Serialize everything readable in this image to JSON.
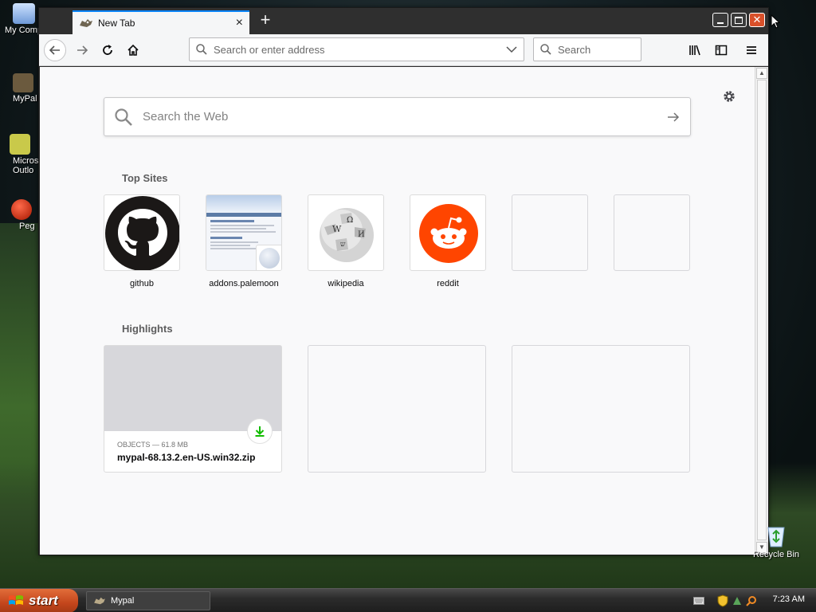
{
  "desktop": {
    "icons": [
      {
        "label": "My Comp"
      },
      {
        "label": "MyPal"
      },
      {
        "label": "Micros Outlo"
      },
      {
        "label": "Peg"
      }
    ],
    "recycle_bin": "Recycle Bin"
  },
  "browser": {
    "tab": {
      "title": "New Tab"
    },
    "urlbar": {
      "placeholder": "Search or enter address"
    },
    "searchbar": {
      "placeholder": "Search"
    },
    "newtab": {
      "websearch_placeholder": "Search the Web",
      "top_sites_title": "Top Sites",
      "top_sites": [
        {
          "label": "github"
        },
        {
          "label": "addons.palemoon"
        },
        {
          "label": "wikipedia"
        },
        {
          "label": "reddit"
        },
        {
          "label": ""
        },
        {
          "label": ""
        }
      ],
      "highlights_title": "Highlights",
      "highlights": [
        {
          "meta": "OBJECTS — 61.8 MB",
          "name": "mypal-68.13.2.en-US.win32.zip"
        }
      ]
    }
  },
  "taskbar": {
    "start_label": "start",
    "tasks": [
      {
        "label": "Mypal"
      }
    ],
    "clock": "7:23 AM"
  },
  "colors": {
    "accent": "#0a84ff",
    "start_button": "#c4461c",
    "reddit": "#ff4500",
    "download_green": "#12bc00"
  }
}
